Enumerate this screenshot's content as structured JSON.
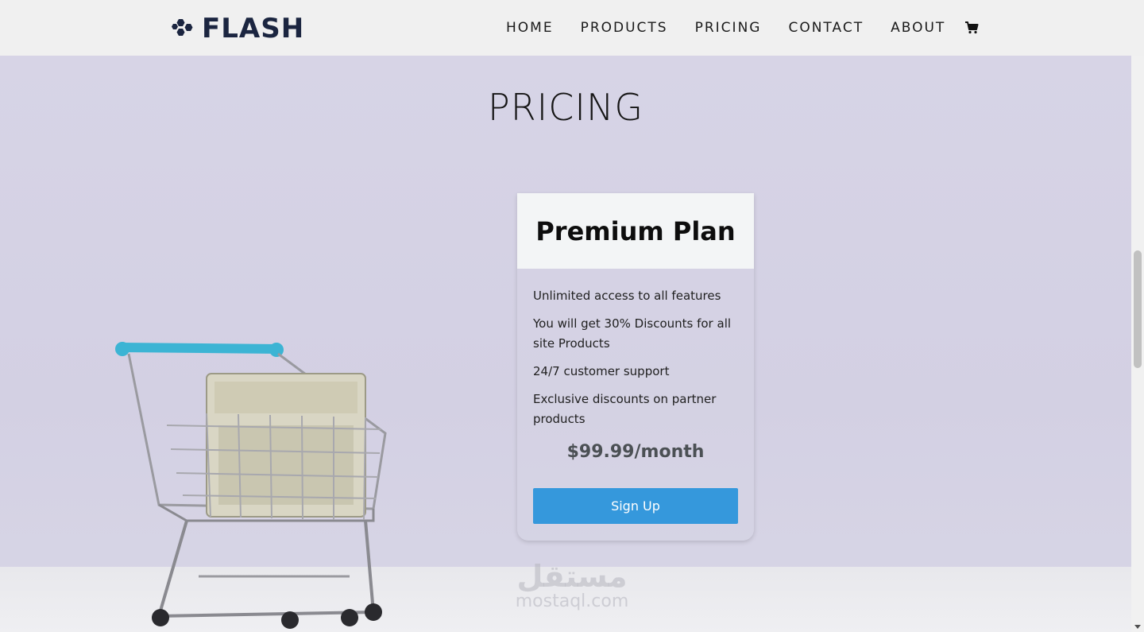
{
  "header": {
    "brand": "FLASH",
    "nav": [
      {
        "label": "HOME"
      },
      {
        "label": "PRODUCTS"
      },
      {
        "label": "PRICING"
      },
      {
        "label": "CONTACT"
      },
      {
        "label": "ABOUT"
      }
    ],
    "cart_icon": "shopping-cart-icon"
  },
  "main": {
    "title": "PRICING",
    "plan": {
      "name": "Premium Plan",
      "features": [
        "Unlimited access to all features",
        "You will get 30% Discounts for all site Products",
        "24/7 customer support",
        "Exclusive discounts on partner products"
      ],
      "price": "$99.99/month",
      "cta": "Sign Up"
    }
  },
  "watermark": {
    "arabic": "مستقل",
    "latin": "mostaql.com"
  },
  "colors": {
    "accent": "#3598dc",
    "brand": "#1b2540",
    "background": "#d7d4e6"
  }
}
